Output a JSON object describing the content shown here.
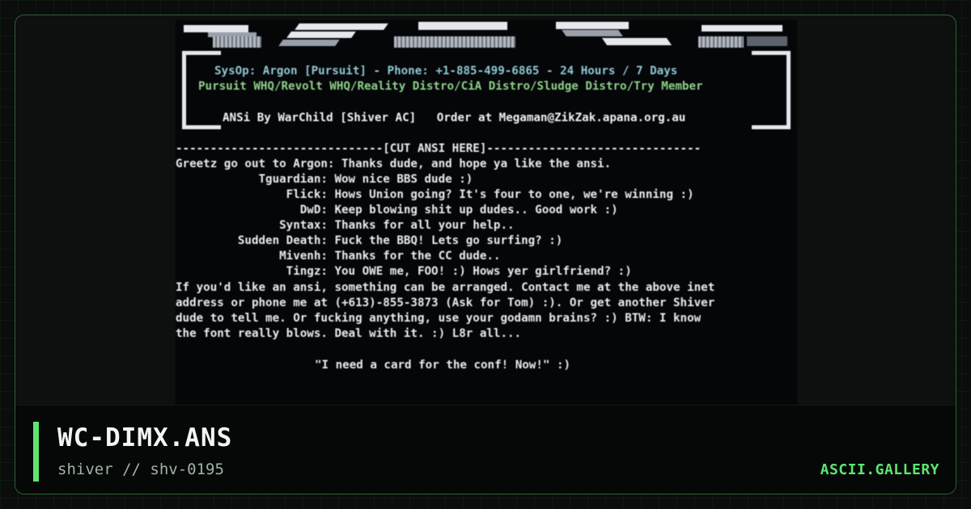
{
  "artwork": {
    "header": {
      "sysop_line": "SysOp: Argon [Pursuit] - Phone: +1-885-499-6865 - 24 Hours / 7 Days",
      "affil_line": "Pursuit WHQ/Revolt WHQ/Reality Distro/CiA Distro/Sludge Distro/Try Member",
      "credit_line": "ANSi By WarChild [Shiver AC]   Order at Megaman@ZikZak.apana.org.au"
    },
    "cut_line": "------------------------------[CUT ANSI HERE]-------------------------------",
    "greets": [
      "Greetz go out to Argon: Thanks dude, and hope ya like the ansi.",
      "            Tguardian: Wow nice BBS dude :)",
      "                Flick: Hows Union going? It's four to one, we're winning :)",
      "                  DwD: Keep blowing shit up dudes.. Good work :)",
      "               Syntax: Thanks for all your help..",
      "         Sudden Death: Fuck the BBQ! Lets go surfing? :)",
      "               Mivenh: Thanks for the CC dude..",
      "                Tingz: You OWE me, FOO! :) Hows yer girlfriend? :)"
    ],
    "closing": [
      "If you'd like an ansi, something can be arranged. Contact me at the above inet",
      "address or phone me at (+613)-855-3873 (Ask for Tom) :). Or get another Shiver",
      "dude to tell me. Or fucking anything, use your godamn brains? :) BTW: I know",
      "the font really blows. Deal with it. :) L8r all..."
    ],
    "quote": "\"I need a card for the conf! Now!\" :)"
  },
  "footer": {
    "title": "WC-DIMX.ANS",
    "subtitle": "shiver // shv-0195",
    "brand": "ASCII.GALLERY"
  },
  "colors": {
    "accent": "#5ee56f",
    "art_bg": "#050608",
    "cyan_text": "#8fc7d2",
    "green_text": "#8fd08a"
  }
}
